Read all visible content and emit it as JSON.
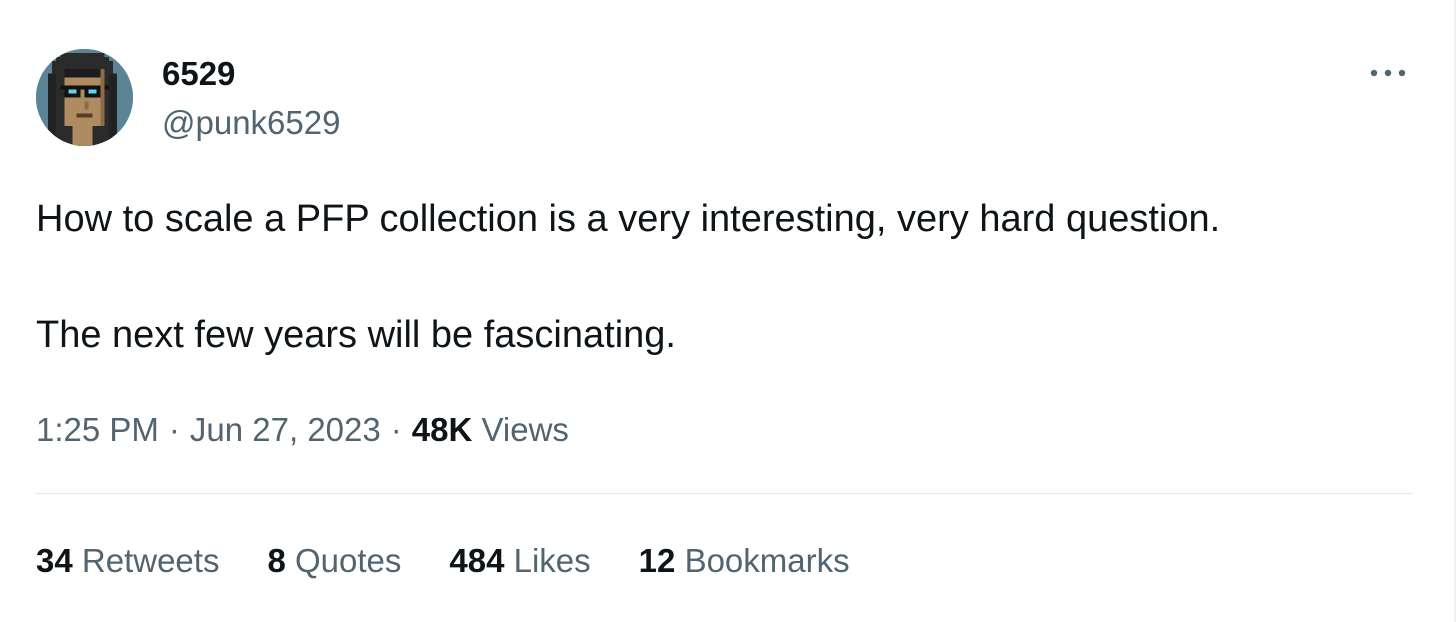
{
  "author": {
    "display_name": "6529",
    "handle": "@punk6529",
    "avatar": "cryptopunk-avatar"
  },
  "menu": {
    "icon": "more-horizontal-icon"
  },
  "tweet": {
    "paragraphs": [
      "How to scale a PFP collection is a very interesting, very hard question.",
      "The next few years will be fascinating."
    ]
  },
  "meta": {
    "time": "1:25 PM",
    "separator": "·",
    "date": "Jun 27, 2023",
    "views_count": "48K",
    "views_label": "Views"
  },
  "stats": [
    {
      "count": "34",
      "label": "Retweets"
    },
    {
      "count": "8",
      "label": "Quotes"
    },
    {
      "count": "484",
      "label": "Likes"
    },
    {
      "count": "12",
      "label": "Bookmarks"
    }
  ],
  "colors": {
    "primary_text": "#0f1419",
    "secondary_text": "#536471",
    "divider": "#e4e8ea",
    "avatar_bg": "#5b8497"
  }
}
